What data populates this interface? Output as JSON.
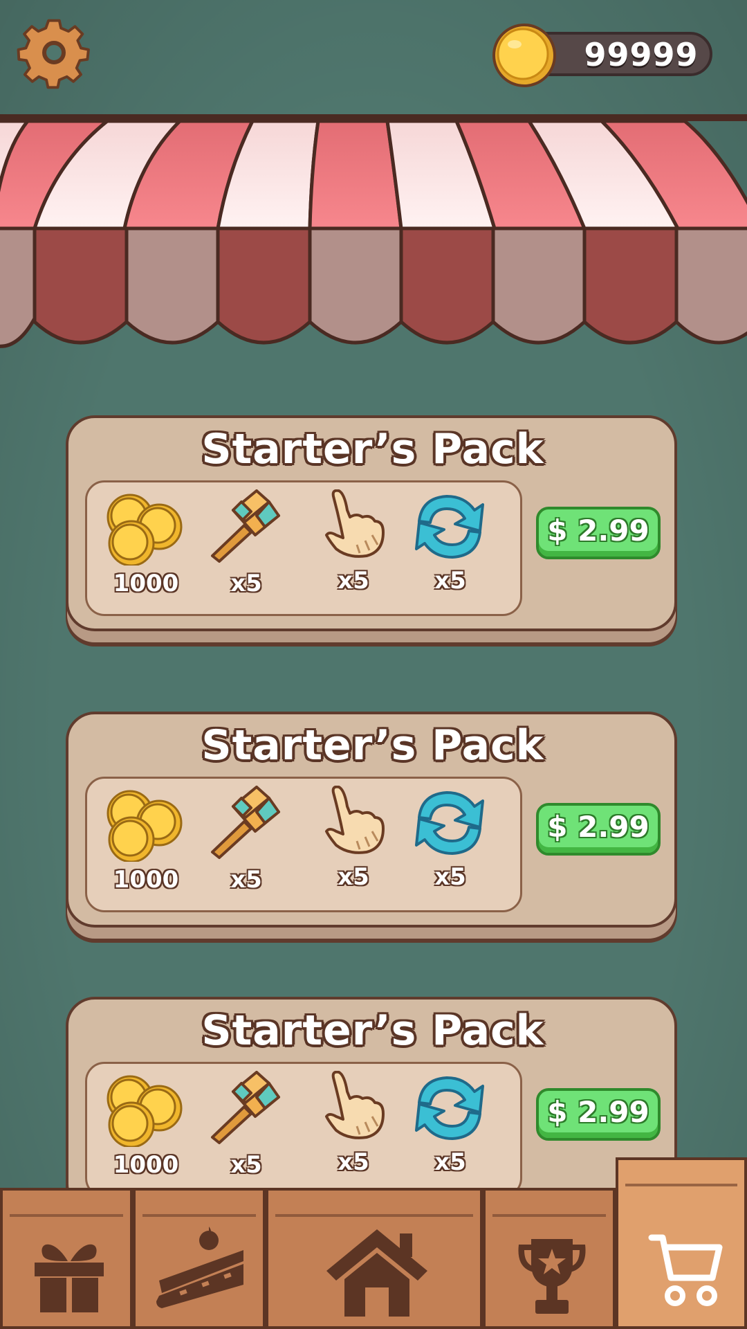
{
  "header": {
    "coins": "99999",
    "settings_icon": "gear-icon",
    "coin_icon": "coin-icon"
  },
  "colors": {
    "background": "#4f766d",
    "card": "#d3bba3",
    "card_inner": "#e6cfba",
    "buy_button": "#6fe277",
    "awning_red": "#e5757c",
    "awning_light": "#f1dcdc",
    "nav_tab": "#c38055",
    "nav_tab_active": "#e0a06d"
  },
  "packs": [
    {
      "title": "Starter’s Pack",
      "price": "$ 2.99",
      "items": [
        {
          "icon": "coins-icon",
          "qty": "1000"
        },
        {
          "icon": "hammer-icon",
          "qty": "x5"
        },
        {
          "icon": "pointer-hand-icon",
          "qty": "x5"
        },
        {
          "icon": "shuffle-icon",
          "qty": "x5"
        }
      ]
    },
    {
      "title": "Starter’s Pack",
      "price": "$ 2.99",
      "items": [
        {
          "icon": "coins-icon",
          "qty": "1000"
        },
        {
          "icon": "hammer-icon",
          "qty": "x5"
        },
        {
          "icon": "pointer-hand-icon",
          "qty": "x5"
        },
        {
          "icon": "shuffle-icon",
          "qty": "x5"
        }
      ]
    },
    {
      "title": "Starter’s Pack",
      "price": "$ 2.99",
      "items": [
        {
          "icon": "coins-icon",
          "qty": "1000"
        },
        {
          "icon": "hammer-icon",
          "qty": "x5"
        },
        {
          "icon": "pointer-hand-icon",
          "qty": "x5"
        },
        {
          "icon": "shuffle-icon",
          "qty": "x5"
        }
      ]
    }
  ],
  "nav": {
    "tabs": [
      {
        "icon": "gift-icon",
        "active": false
      },
      {
        "icon": "cake-icon",
        "active": false
      },
      {
        "icon": "home-icon",
        "active": false
      },
      {
        "icon": "trophy-icon",
        "active": false
      },
      {
        "icon": "cart-icon",
        "active": true
      }
    ]
  }
}
